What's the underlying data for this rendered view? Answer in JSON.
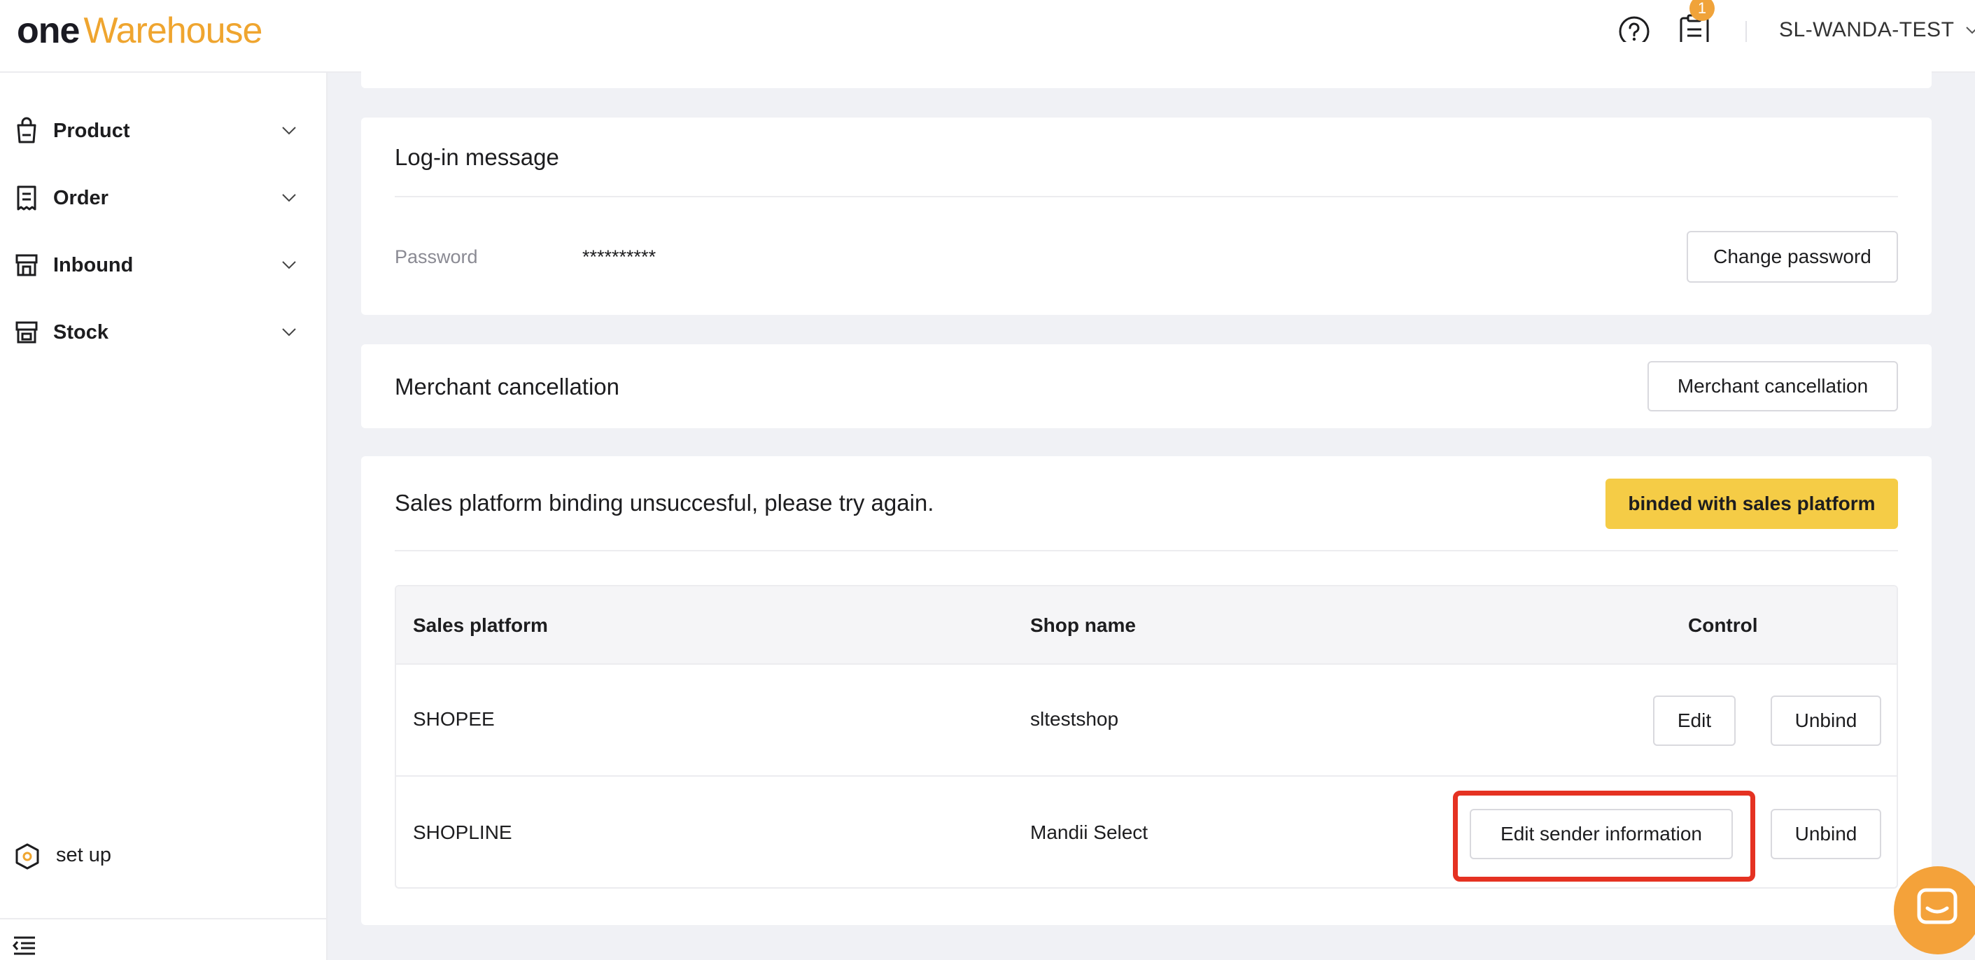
{
  "header": {
    "logo_part1": "one",
    "logo_part2": "Warehouse",
    "notification_count": "1",
    "username": "SL-WANDA-TEST"
  },
  "sidebar": {
    "items": [
      {
        "label": "Product",
        "icon": "bag-icon"
      },
      {
        "label": "Order",
        "icon": "receipt-icon"
      },
      {
        "label": "Inbound",
        "icon": "store-icon"
      },
      {
        "label": "Stock",
        "icon": "warehouse-icon"
      }
    ],
    "setup_label": "set up"
  },
  "login_card": {
    "title": "Log-in message",
    "password_label": "Password",
    "password_value": "**********",
    "change_button": "Change password"
  },
  "merchant_card": {
    "title": "Merchant cancellation",
    "button": "Merchant cancellation"
  },
  "sales_card": {
    "title": "Sales platform binding unsuccesful, please try again.",
    "bind_button": "binded with sales platform",
    "table": {
      "headers": [
        "Sales platform",
        "Shop name",
        "Control"
      ],
      "rows": [
        {
          "platform": "SHOPEE",
          "shop": "sltestshop",
          "action1": "Edit",
          "action2": "Unbind"
        },
        {
          "platform": "SHOPLINE",
          "shop": "Mandii Select",
          "action1": "Edit sender information",
          "action2": "Unbind"
        }
      ]
    }
  },
  "colors": {
    "brand_orange": "#efa52f",
    "accent_yellow": "#f5cc46",
    "highlight_red": "#e53222"
  }
}
